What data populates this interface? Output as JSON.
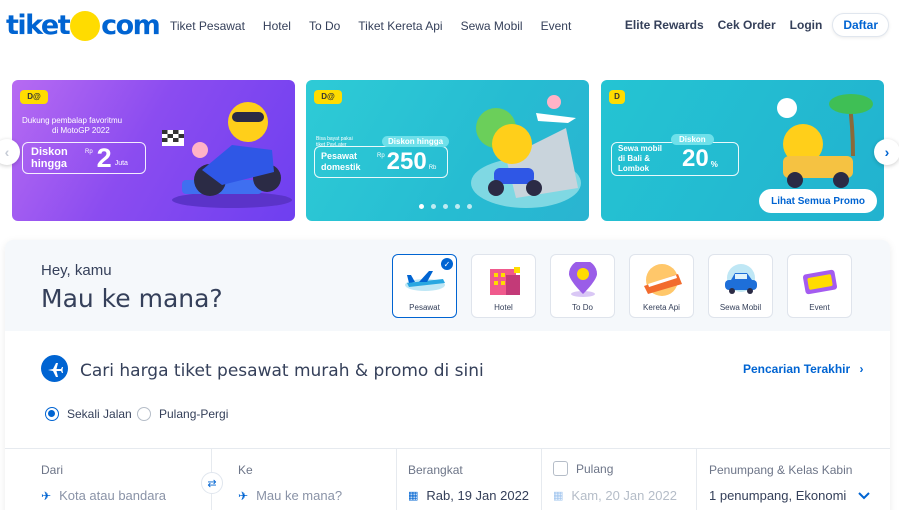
{
  "header": {
    "logo_left": "tiket",
    "logo_right": "com",
    "nav": [
      "Tiket Pesawat",
      "Hotel",
      "To Do",
      "Tiket Kereta Api",
      "Sewa Mobil",
      "Event"
    ],
    "elite_rewards": "Elite Rewards",
    "cek_order": "Cek Order",
    "login": "Login",
    "daftar": "Daftar"
  },
  "banners": {
    "b1": {
      "badge": "D@",
      "line1": "Dukung pembalap favoritmu",
      "line2": "di MotoGP 2022",
      "pill_text": "Diskon hingga",
      "rp": "Rp",
      "amount": "2",
      "unit": "Juta"
    },
    "b2": {
      "badge": "D@",
      "paylater": "Bisa bayat pakai tiket PayLater",
      "pill_title": "Diskon hingga",
      "pill_text": "Pesawat domestik",
      "rp": "Rp",
      "amount": "250",
      "unit": "Rb"
    },
    "b3": {
      "badge": "D",
      "pill_title": "Diskon",
      "pill_text": "Sewa mobil di Bali & Lombok",
      "amount": "20",
      "unit": "%",
      "cta": "Lihat Semua Promo"
    }
  },
  "search": {
    "greeting": "Hey, kamu",
    "question": "Mau ke mana?",
    "products": [
      "Pesawat",
      "Hotel",
      "To Do",
      "Kereta Api",
      "Sewa Mobil",
      "Event"
    ],
    "headline": "Cari harga tiket pesawat murah & promo di sini",
    "recent": "Pencarian Terakhir",
    "trip_one_way": "Sekali Jalan",
    "trip_round": "Pulang-Pergi",
    "from_label": "Dari",
    "from_placeholder": "Kota atau bandara",
    "to_label": "Ke",
    "to_placeholder": "Mau ke mana?",
    "depart_label": "Berangkat",
    "depart_value": "Rab, 19 Jan 2022",
    "return_label": "Pulang",
    "return_value": "Kam, 20 Jan 2022",
    "pax_label": "Penumpang & Kelas Kabin",
    "pax_value": "1 penumpang, Ekonomi"
  },
  "colors": {
    "brand_blue": "#0064d2",
    "brand_yellow": "#ffdc00",
    "text_dark": "#35405a"
  }
}
